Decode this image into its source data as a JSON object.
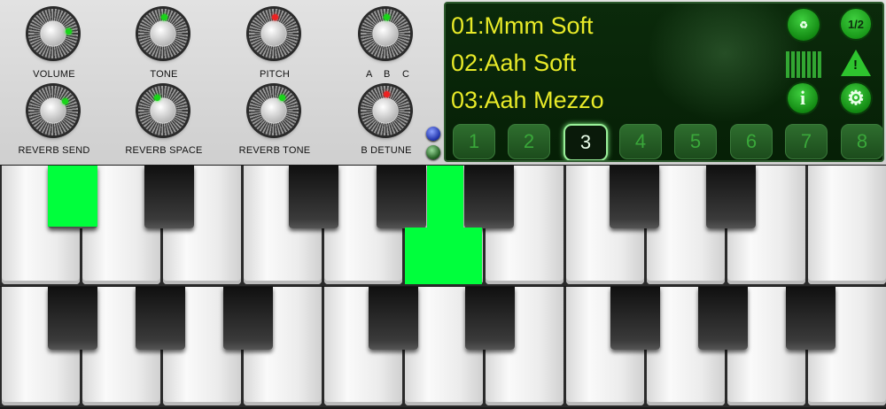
{
  "knobs": [
    {
      "label": "VOLUME"
    },
    {
      "label": "TONE"
    },
    {
      "label": "PITCH"
    },
    {
      "label": "REVERB SEND"
    },
    {
      "label": "REVERB SPACE"
    },
    {
      "label": "REVERB TONE"
    },
    {
      "label": "B DETUNE"
    }
  ],
  "abc_labels": [
    "A",
    "B",
    "C"
  ],
  "display": {
    "presets": [
      "01:Mmm Soft",
      "02:Aah Soft",
      "03:Aah Mezzo"
    ],
    "page_button": "1/2",
    "info_button": "i",
    "slots": [
      "1",
      "2",
      "3",
      "4",
      "5",
      "6",
      "7",
      "8"
    ],
    "active_slot": 3,
    "accent": "#e8ea28",
    "lcd_green": "#2ec42e"
  },
  "keyboard": {
    "pressed_color": "#00ff3c"
  }
}
